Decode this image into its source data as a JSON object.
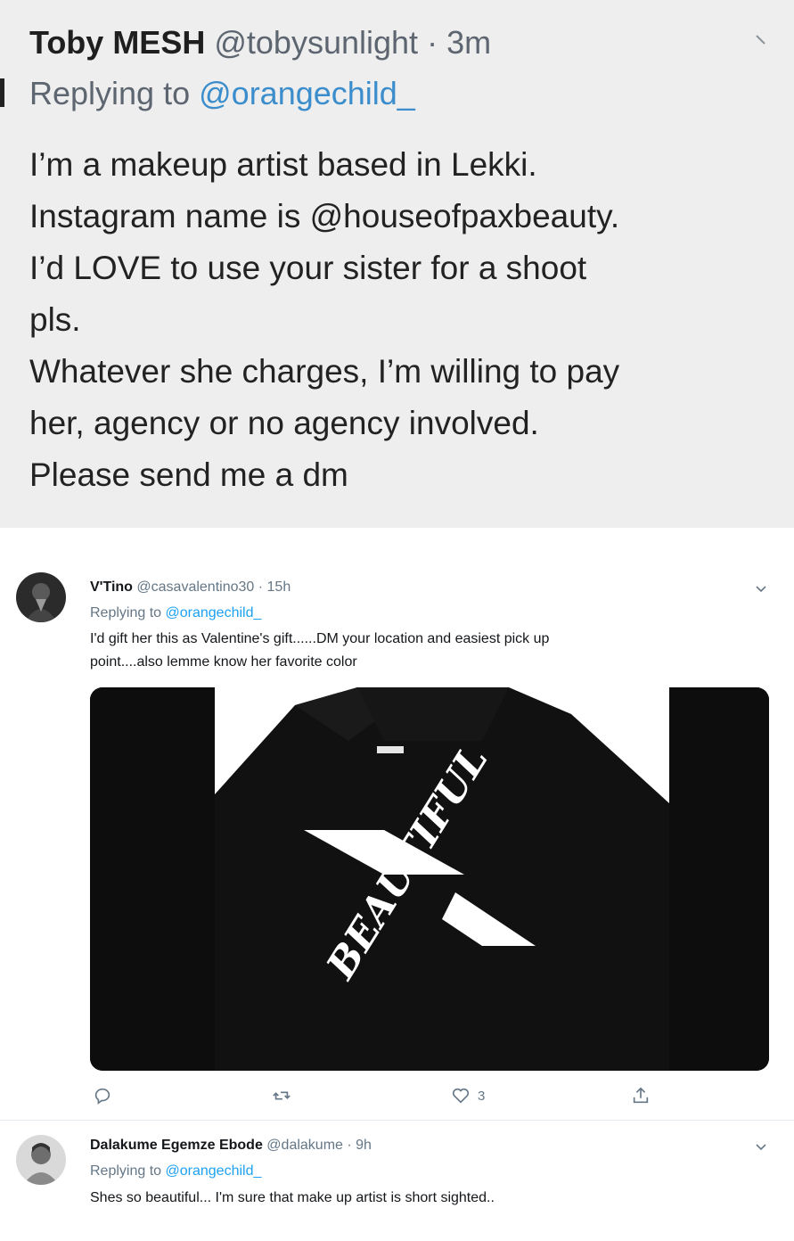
{
  "top_tweet": {
    "name": "Toby MESH",
    "handle": "@tobysunlight",
    "separator": "·",
    "time": "3m",
    "replying_prefix": "Replying to",
    "replying_to": "@orangechild_",
    "lines": [
      "I’m a makeup artist based in Lekki.",
      "Instagram name is @houseofpaxbeauty.",
      "I’d LOVE to use your sister for a shoot",
      "pls.",
      "Whatever she charges, I’m willing to pay",
      "her, agency or no agency involved.",
      "Please send me a dm"
    ]
  },
  "tweet1": {
    "name": "V'Tino",
    "handle": "@casavalentino30",
    "separator": "·",
    "time": "15h",
    "replying_prefix": "Replying to",
    "replying_to": "@orangechild_",
    "lines": [
      "I'd gift her this as Valentine's gift......DM your location and easiest pick up",
      "point....also lemme know her favorite color"
    ],
    "image_text": "BEAUTIFUL",
    "actions": {
      "reply_icon": "reply-icon",
      "retweet_icon": "retweet-icon",
      "like_icon": "heart-icon",
      "like_count": "3",
      "share_icon": "share-icon"
    }
  },
  "tweet2": {
    "name": "Dalakume Egemze Ebode",
    "handle": "@dalakume",
    "separator": "·",
    "time": "9h",
    "replying_prefix": "Replying to",
    "replying_to": "@orangechild_",
    "lines": [
      "Shes so beautiful... I'm sure that make up artist is short sighted.."
    ]
  },
  "colors": {
    "link": "#1da1f2",
    "secondary_text": "#657786",
    "top_panel_bg": "#eeeeee"
  }
}
